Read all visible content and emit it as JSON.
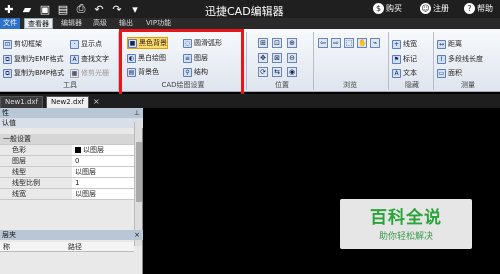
{
  "window": {
    "title": "迅捷CAD编辑器",
    "right": [
      {
        "icon": "dollar-icon",
        "label": "购买"
      },
      {
        "icon": "user-icon",
        "label": "注册"
      },
      {
        "icon": "help-icon",
        "label": "帮助"
      }
    ]
  },
  "menu": {
    "items": [
      "文件",
      "查看器",
      "编辑器",
      "高级",
      "输出",
      "VIP功能"
    ],
    "active_index": 0,
    "selected_index": 1
  },
  "ribbon": {
    "tools": {
      "items": [
        "剪切框架",
        "复制为EMF格式",
        "复制为BMP格式",
        "显示点",
        "查找文字",
        "修剪光栅"
      ],
      "group": "工具"
    },
    "cad": {
      "items": [
        "黑色背景",
        "黑白绘图",
        "背景色",
        "圆滑弧形",
        "图层",
        "结构"
      ],
      "group": "CAD绘图设置"
    },
    "position": {
      "group": "位置"
    },
    "browse": {
      "group": "浏览"
    },
    "hide": {
      "items": [
        "线宽",
        "标记",
        "文本"
      ],
      "group": "隐藏"
    },
    "measure": {
      "items": [
        "距离",
        "多段线长度",
        "面积"
      ],
      "group": "测量"
    }
  },
  "tabs": [
    "New1.dxf",
    "New2.dxf"
  ],
  "panel": {
    "title": "性",
    "pin": "⊥",
    "section_header": "认值",
    "category": "一般设置",
    "properties": [
      {
        "k": "色彩",
        "v": "以图层"
      },
      {
        "k": "图层",
        "v": "0"
      },
      {
        "k": "线型",
        "v": "以图层"
      },
      {
        "k": "线型比例",
        "v": "1"
      },
      {
        "k": "线宽",
        "v": "以图层"
      }
    ],
    "bottom_title": "层夹",
    "columns": [
      "称",
      "路径"
    ]
  },
  "watermark": {
    "title": "百科全说",
    "subtitle": "助你轻松解决"
  },
  "colors": {
    "highlight": "#ffd96b",
    "red_box": "#e8161c",
    "menu_active": "#2d72c8"
  }
}
